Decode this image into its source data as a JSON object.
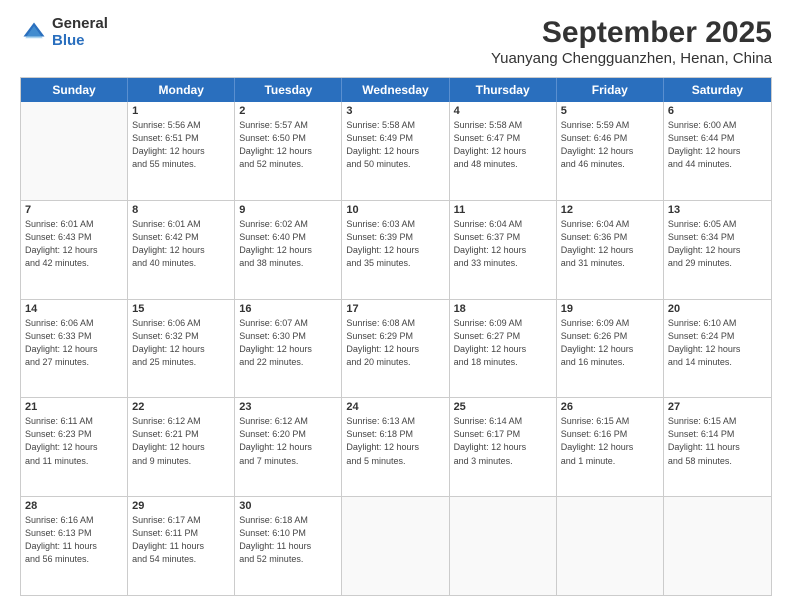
{
  "logo": {
    "general": "General",
    "blue": "Blue"
  },
  "title": "September 2025",
  "subtitle": "Yuanyang Chengguanzhen, Henan, China",
  "header_days": [
    "Sunday",
    "Monday",
    "Tuesday",
    "Wednesday",
    "Thursday",
    "Friday",
    "Saturday"
  ],
  "rows": [
    [
      {
        "day": "",
        "info": ""
      },
      {
        "day": "1",
        "info": "Sunrise: 5:56 AM\nSunset: 6:51 PM\nDaylight: 12 hours\nand 55 minutes."
      },
      {
        "day": "2",
        "info": "Sunrise: 5:57 AM\nSunset: 6:50 PM\nDaylight: 12 hours\nand 52 minutes."
      },
      {
        "day": "3",
        "info": "Sunrise: 5:58 AM\nSunset: 6:49 PM\nDaylight: 12 hours\nand 50 minutes."
      },
      {
        "day": "4",
        "info": "Sunrise: 5:58 AM\nSunset: 6:47 PM\nDaylight: 12 hours\nand 48 minutes."
      },
      {
        "day": "5",
        "info": "Sunrise: 5:59 AM\nSunset: 6:46 PM\nDaylight: 12 hours\nand 46 minutes."
      },
      {
        "day": "6",
        "info": "Sunrise: 6:00 AM\nSunset: 6:44 PM\nDaylight: 12 hours\nand 44 minutes."
      }
    ],
    [
      {
        "day": "7",
        "info": "Sunrise: 6:01 AM\nSunset: 6:43 PM\nDaylight: 12 hours\nand 42 minutes."
      },
      {
        "day": "8",
        "info": "Sunrise: 6:01 AM\nSunset: 6:42 PM\nDaylight: 12 hours\nand 40 minutes."
      },
      {
        "day": "9",
        "info": "Sunrise: 6:02 AM\nSunset: 6:40 PM\nDaylight: 12 hours\nand 38 minutes."
      },
      {
        "day": "10",
        "info": "Sunrise: 6:03 AM\nSunset: 6:39 PM\nDaylight: 12 hours\nand 35 minutes."
      },
      {
        "day": "11",
        "info": "Sunrise: 6:04 AM\nSunset: 6:37 PM\nDaylight: 12 hours\nand 33 minutes."
      },
      {
        "day": "12",
        "info": "Sunrise: 6:04 AM\nSunset: 6:36 PM\nDaylight: 12 hours\nand 31 minutes."
      },
      {
        "day": "13",
        "info": "Sunrise: 6:05 AM\nSunset: 6:34 PM\nDaylight: 12 hours\nand 29 minutes."
      }
    ],
    [
      {
        "day": "14",
        "info": "Sunrise: 6:06 AM\nSunset: 6:33 PM\nDaylight: 12 hours\nand 27 minutes."
      },
      {
        "day": "15",
        "info": "Sunrise: 6:06 AM\nSunset: 6:32 PM\nDaylight: 12 hours\nand 25 minutes."
      },
      {
        "day": "16",
        "info": "Sunrise: 6:07 AM\nSunset: 6:30 PM\nDaylight: 12 hours\nand 22 minutes."
      },
      {
        "day": "17",
        "info": "Sunrise: 6:08 AM\nSunset: 6:29 PM\nDaylight: 12 hours\nand 20 minutes."
      },
      {
        "day": "18",
        "info": "Sunrise: 6:09 AM\nSunset: 6:27 PM\nDaylight: 12 hours\nand 18 minutes."
      },
      {
        "day": "19",
        "info": "Sunrise: 6:09 AM\nSunset: 6:26 PM\nDaylight: 12 hours\nand 16 minutes."
      },
      {
        "day": "20",
        "info": "Sunrise: 6:10 AM\nSunset: 6:24 PM\nDaylight: 12 hours\nand 14 minutes."
      }
    ],
    [
      {
        "day": "21",
        "info": "Sunrise: 6:11 AM\nSunset: 6:23 PM\nDaylight: 12 hours\nand 11 minutes."
      },
      {
        "day": "22",
        "info": "Sunrise: 6:12 AM\nSunset: 6:21 PM\nDaylight: 12 hours\nand 9 minutes."
      },
      {
        "day": "23",
        "info": "Sunrise: 6:12 AM\nSunset: 6:20 PM\nDaylight: 12 hours\nand 7 minutes."
      },
      {
        "day": "24",
        "info": "Sunrise: 6:13 AM\nSunset: 6:18 PM\nDaylight: 12 hours\nand 5 minutes."
      },
      {
        "day": "25",
        "info": "Sunrise: 6:14 AM\nSunset: 6:17 PM\nDaylight: 12 hours\nand 3 minutes."
      },
      {
        "day": "26",
        "info": "Sunrise: 6:15 AM\nSunset: 6:16 PM\nDaylight: 12 hours\nand 1 minute."
      },
      {
        "day": "27",
        "info": "Sunrise: 6:15 AM\nSunset: 6:14 PM\nDaylight: 11 hours\nand 58 minutes."
      }
    ],
    [
      {
        "day": "28",
        "info": "Sunrise: 6:16 AM\nSunset: 6:13 PM\nDaylight: 11 hours\nand 56 minutes."
      },
      {
        "day": "29",
        "info": "Sunrise: 6:17 AM\nSunset: 6:11 PM\nDaylight: 11 hours\nand 54 minutes."
      },
      {
        "day": "30",
        "info": "Sunrise: 6:18 AM\nSunset: 6:10 PM\nDaylight: 11 hours\nand 52 minutes."
      },
      {
        "day": "",
        "info": ""
      },
      {
        "day": "",
        "info": ""
      },
      {
        "day": "",
        "info": ""
      },
      {
        "day": "",
        "info": ""
      }
    ]
  ]
}
